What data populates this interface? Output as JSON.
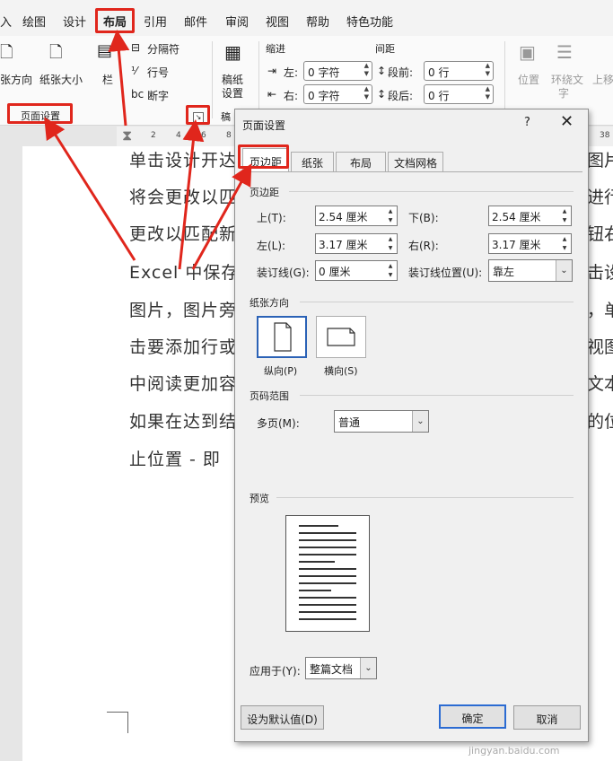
{
  "ribbon_tabs": [
    "入",
    "绘图",
    "设计",
    "布局",
    "引用",
    "邮件",
    "审阅",
    "视图",
    "帮助",
    "特色功能"
  ],
  "ribbon": {
    "orientation_label": "张方向",
    "size_label": "纸张大小",
    "columns_label": "栏",
    "breaks_label": "分隔符",
    "line_numbers_label": "行号",
    "hyphenation_label": "断字",
    "draft_label_1": "稿纸",
    "draft_label_2": "设置",
    "draft_group_label": "稿",
    "group_page_setup": "页面设置",
    "indent_label": "缩进",
    "spacing_label": "间距",
    "indent_left_label": "左:",
    "indent_right_label": "右:",
    "indent_left_value": "0 字符",
    "indent_right_value": "0 字符",
    "spacing_before_label": "段前:",
    "spacing_after_label": "段后:",
    "spacing_before_value": "0 行",
    "spacing_after_value": "0 行",
    "position_label": "位置",
    "wrap_label_1": "环绕文",
    "wrap_label_2": "字",
    "bring_label": "上移"
  },
  "ruler_ticks": [
    "2",
    "4",
    "6",
    "8",
    "38"
  ],
  "document": {
    "lines_left": [
      "单击设计开达",
      "将会更改以匹",
      "更改以匹配新",
      "Excel 中保存",
      "图片，图片旁",
      "击要添加行或",
      "中阅读更加容",
      "如果在达到结",
      "止位置 - 即"
    ],
    "lines_right": [
      "图片",
      "进行",
      "钮右",
      "击设",
      "，单",
      "视图",
      "文本",
      "的位"
    ]
  },
  "dialog": {
    "title": "页面设置",
    "help": "?",
    "close": "✕",
    "tabs": [
      "页边距",
      "纸张",
      "布局",
      "文档网格"
    ],
    "margins_section": "页边距",
    "top_label": "上(T):",
    "top_value": "2.54 厘米",
    "bottom_label": "下(B):",
    "bottom_value": "2.54 厘米",
    "left_label": "左(L):",
    "left_value": "3.17 厘米",
    "right_label": "右(R):",
    "right_value": "3.17 厘米",
    "gutter_label": "装订线(G):",
    "gutter_value": "0 厘米",
    "gutter_pos_label": "装订线位置(U):",
    "gutter_pos_value": "靠左",
    "orientation_section": "纸张方向",
    "portrait_label": "纵向(P)",
    "landscape_label": "横向(S)",
    "pages_section": "页码范围",
    "multi_pages_label": "多页(M):",
    "multi_pages_value": "普通",
    "preview_section": "预览",
    "apply_label": "应用于(Y):",
    "apply_value": "整篇文档",
    "default_button": "设为默认值(D)",
    "ok_button": "确定",
    "cancel_button": "取消"
  },
  "watermark": "jingyan.baidu.com",
  "accent_color": "#e0261c"
}
